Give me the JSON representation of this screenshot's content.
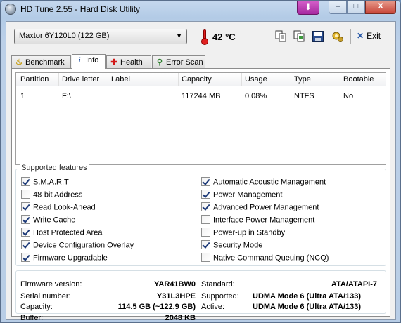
{
  "window": {
    "title": "HD Tune 2.55 - Hard Disk Utility",
    "controls": {
      "minimize": "–",
      "maximize": "□",
      "close": "X"
    }
  },
  "toolbar": {
    "drive": "Maxtor 6Y120L0 (122 GB)",
    "temperature": "42 °C",
    "icons": [
      "copy-text-icon",
      "copy-screenshot-icon",
      "save-icon",
      "options-icon"
    ],
    "exit_label": "Exit"
  },
  "tabs": [
    {
      "label": "Benchmark",
      "icon": "benchmark-icon",
      "active": false
    },
    {
      "label": "Info",
      "icon": "info-icon",
      "active": true
    },
    {
      "label": "Health",
      "icon": "health-icon",
      "active": false
    },
    {
      "label": "Error Scan",
      "icon": "magnifier-icon",
      "active": false
    }
  ],
  "partitions": {
    "columns": [
      "Partition",
      "Drive letter",
      "Label",
      "Capacity",
      "Usage",
      "Type",
      "Bootable"
    ],
    "rows": [
      [
        "1",
        "F:\\",
        "",
        "117244 MB",
        "0.08%",
        "NTFS",
        "No"
      ]
    ]
  },
  "features": {
    "title": "Supported features",
    "left": [
      {
        "label": "S.M.A.R.T",
        "checked": true
      },
      {
        "label": "48-bit Address",
        "checked": false
      },
      {
        "label": "Read Look-Ahead",
        "checked": true
      },
      {
        "label": "Write Cache",
        "checked": true
      },
      {
        "label": "Host Protected Area",
        "checked": true
      },
      {
        "label": "Device Configuration Overlay",
        "checked": true
      },
      {
        "label": "Firmware Upgradable",
        "checked": true
      }
    ],
    "right": [
      {
        "label": "Automatic Acoustic Management",
        "checked": true
      },
      {
        "label": "Power Management",
        "checked": true
      },
      {
        "label": "Advanced Power Management",
        "checked": true
      },
      {
        "label": "Interface Power Management",
        "checked": false
      },
      {
        "label": "Power-up in Standby",
        "checked": false
      },
      {
        "label": "Security Mode",
        "checked": true
      },
      {
        "label": "Native Command Queuing (NCQ)",
        "checked": false
      }
    ]
  },
  "details": {
    "firmware_label": "Firmware version:",
    "firmware": "YAR41BW0",
    "serial_label": "Serial number:",
    "serial": "Y31L3HPE",
    "capacity_label": "Capacity:",
    "capacity": "114.5 GB (~122.9 GB)",
    "buffer_label": "Buffer:",
    "buffer": "2048 KB",
    "standard_label": "Standard:",
    "standard": "ATA/ATAPI-7",
    "supported_label": "Supported:",
    "supported": "UDMA Mode 6 (Ultra ATA/133)",
    "active_label": "Active:",
    "active": "UDMA Mode 6 (Ultra ATA/133)"
  }
}
